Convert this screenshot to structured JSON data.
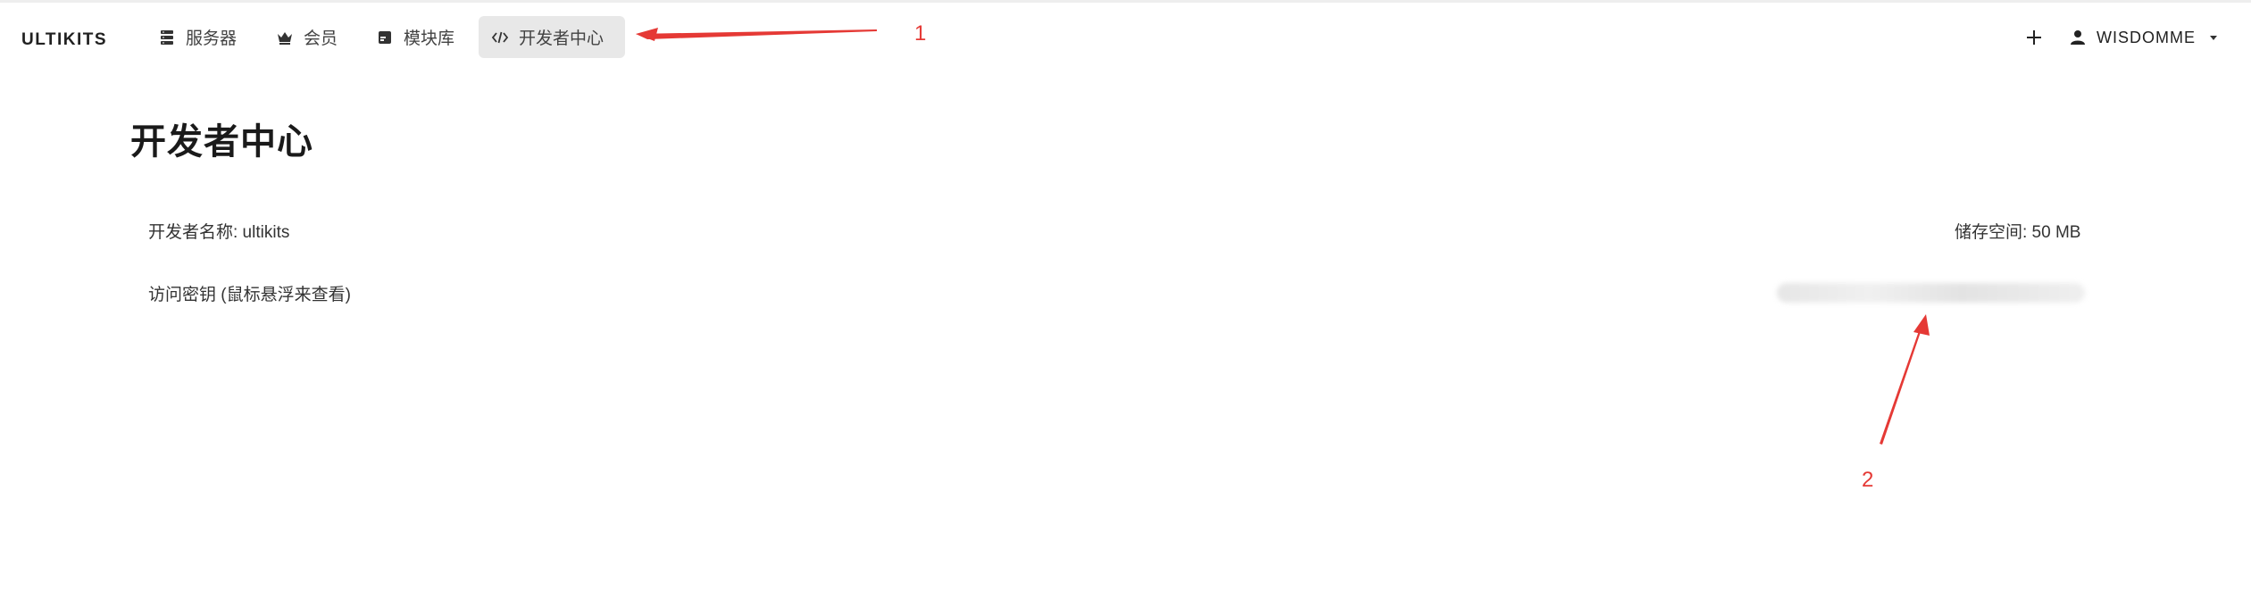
{
  "header": {
    "brand": "ULTIKITS",
    "nav": [
      {
        "label": "服务器",
        "icon": "server-icon"
      },
      {
        "label": "会员",
        "icon": "crown-icon"
      },
      {
        "label": "模块库",
        "icon": "module-icon"
      },
      {
        "label": "开发者中心",
        "icon": "code-icon",
        "active": true
      }
    ],
    "add_icon": "plus-icon",
    "user": {
      "name": "WISDOMME",
      "icon": "person-icon",
      "dropdown_icon": "caret-down-icon"
    }
  },
  "main": {
    "title": "开发者中心",
    "developer_name": "开发者名称: ultikits",
    "storage": "储存空间: 50 MB",
    "access_key_label": "访问密钥 (鼠标悬浮来查看)"
  },
  "annotations": {
    "label_1": "1",
    "label_2": "2",
    "color": "#e53935"
  },
  "colors": {
    "active_nav_bg": "#e8e8e8",
    "text": "#212121"
  }
}
